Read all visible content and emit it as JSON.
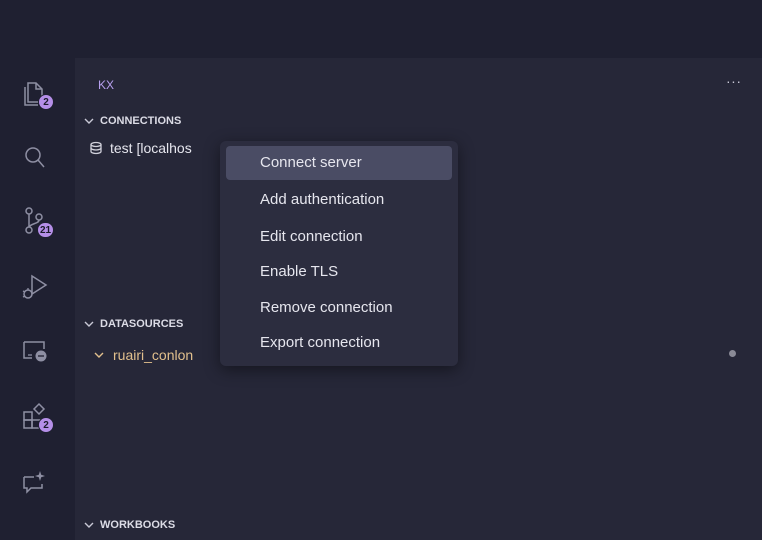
{
  "activity_bar": {
    "explorer_badge": "2",
    "source_control_badge": "21",
    "extensions_badge": "2"
  },
  "sidebar": {
    "title": "KX",
    "more_label": "···",
    "connections": {
      "label": "CONNECTIONS",
      "items": [
        {
          "label": "test [localhos"
        }
      ]
    },
    "datasources": {
      "label": "DATASOURCES",
      "items": [
        {
          "label": "ruairi_conlon"
        }
      ]
    },
    "workbooks": {
      "label": "WORKBOOKS"
    }
  },
  "context_menu": {
    "items": [
      {
        "label": "Connect server"
      },
      {
        "label": "Add authentication"
      },
      {
        "label": "Edit connection"
      },
      {
        "label": "Enable TLS"
      },
      {
        "label": "Remove connection"
      },
      {
        "label": "Export connection"
      }
    ],
    "highlighted": "Connect server"
  },
  "colors": {
    "accent": "#b58fe8",
    "datasource_text": "#e2c08d"
  }
}
